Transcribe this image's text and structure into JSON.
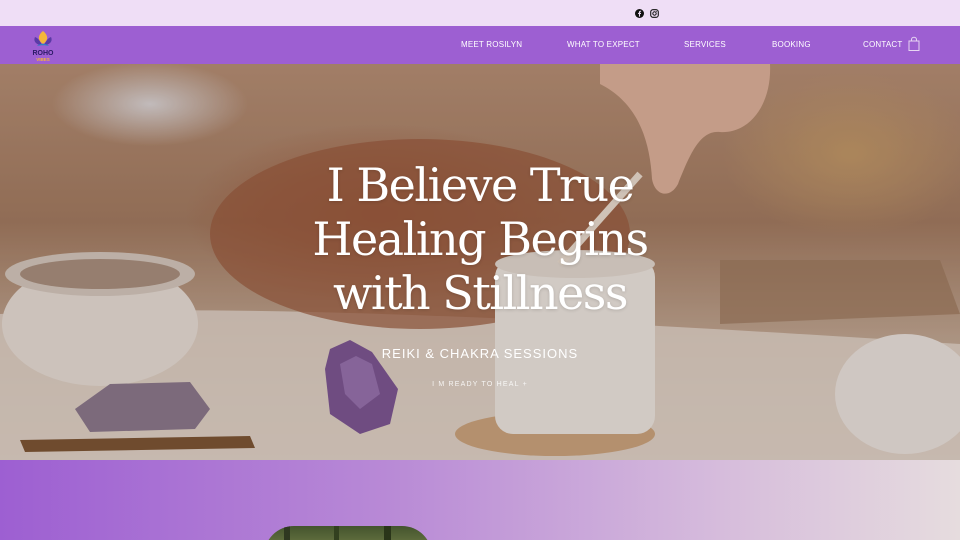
{
  "topbar": {
    "social": [
      {
        "name": "facebook-icon"
      },
      {
        "name": "instagram-icon"
      }
    ]
  },
  "nav": {
    "logo_text": "ROHO",
    "logo_sub": "VIBES",
    "items": [
      {
        "label": "MEET ROSILYN"
      },
      {
        "label": "WHAT TO EXPECT"
      },
      {
        "label": "SERVICES"
      },
      {
        "label": "BOOKING"
      },
      {
        "label": "CONTACT"
      }
    ],
    "cart_icon": "shopping-bag-icon"
  },
  "hero": {
    "title_lines": [
      "I Believe True",
      "Healing Begins",
      "with Stillness"
    ],
    "subtitle": "REIKI & CHAKRA SESSIONS",
    "cta": "I M READY TO HEAL +"
  },
  "colors": {
    "nav_purple": "#9d5fd2",
    "topbar_lilac": "#efdef6",
    "white": "#ffffff"
  }
}
